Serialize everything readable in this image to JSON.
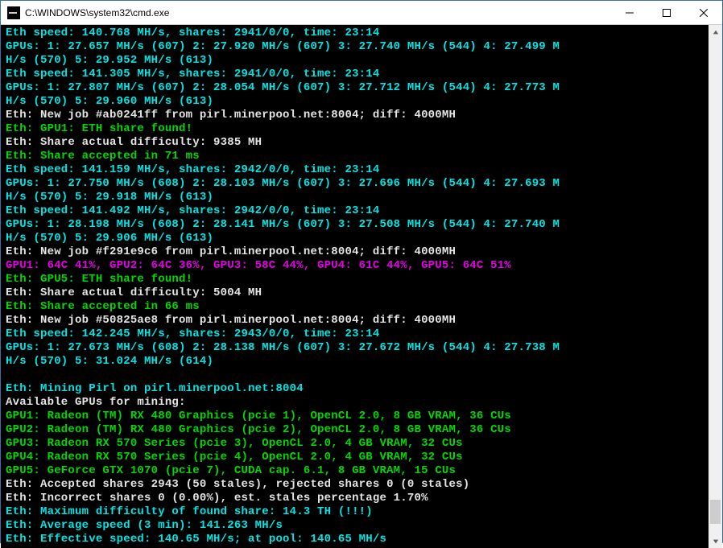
{
  "window": {
    "title": "C:\\WINDOWS\\system32\\cmd.exe"
  },
  "lines": [
    {
      "cls": "c-cyan",
      "t": "Eth speed: 140.768 MH/s, shares: 2941/0/0, time: 23:14"
    },
    {
      "cls": "c-cyan",
      "t": "GPUs: 1: 27.657 MH/s (607) 2: 27.920 MH/s (607) 3: 27.740 MH/s (544) 4: 27.499 M"
    },
    {
      "cls": "c-cyan",
      "t": "H/s (570) 5: 29.952 MH/s (613)"
    },
    {
      "cls": "c-cyan",
      "t": "Eth speed: 141.305 MH/s, shares: 2941/0/0, time: 23:14"
    },
    {
      "cls": "c-cyan",
      "t": "GPUs: 1: 27.807 MH/s (607) 2: 28.054 MH/s (607) 3: 27.712 MH/s (544) 4: 27.773 M"
    },
    {
      "cls": "c-cyan",
      "t": "H/s (570) 5: 29.960 MH/s (613)"
    },
    {
      "cls": "c-white",
      "t": "Eth: New job #ab0241ff from pirl.minerpool.net:8004; diff: 4000MH"
    },
    {
      "cls": "c-green",
      "t": "Eth: GPU1: ETH share found!"
    },
    {
      "cls": "c-white",
      "t": "Eth: Share actual difficulty: 9385 MH"
    },
    {
      "cls": "c-green",
      "t": "Eth: Share accepted in 71 ms"
    },
    {
      "cls": "c-cyan",
      "t": "Eth speed: 141.159 MH/s, shares: 2942/0/0, time: 23:14"
    },
    {
      "cls": "c-cyan",
      "t": "GPUs: 1: 27.750 MH/s (608) 2: 28.103 MH/s (607) 3: 27.696 MH/s (544) 4: 27.693 M"
    },
    {
      "cls": "c-cyan",
      "t": "H/s (570) 5: 29.918 MH/s (613)"
    },
    {
      "cls": "c-cyan",
      "t": "Eth speed: 141.492 MH/s, shares: 2942/0/0, time: 23:14"
    },
    {
      "cls": "c-cyan",
      "t": "GPUs: 1: 28.198 MH/s (608) 2: 28.141 MH/s (607) 3: 27.508 MH/s (544) 4: 27.740 M"
    },
    {
      "cls": "c-cyan",
      "t": "H/s (570) 5: 29.906 MH/s (613)"
    },
    {
      "cls": "c-white",
      "t": "Eth: New job #f291e9c6 from pirl.minerpool.net:8004; diff: 4000MH"
    },
    {
      "cls": "c-magenta",
      "t": "GPU1: 64C 41%, GPU2: 64C 36%, GPU3: 58C 44%, GPU4: 61C 44%, GPU5: 64C 51%"
    },
    {
      "cls": "c-green",
      "t": "Eth: GPU5: ETH share found!"
    },
    {
      "cls": "c-white",
      "t": "Eth: Share actual difficulty: 5004 MH"
    },
    {
      "cls": "c-green",
      "t": "Eth: Share accepted in 66 ms"
    },
    {
      "cls": "c-white",
      "t": "Eth: New job #50825ae8 from pirl.minerpool.net:8004; diff: 4000MH"
    },
    {
      "cls": "c-cyan",
      "t": "Eth speed: 142.245 MH/s, shares: 2943/0/0, time: 23:14"
    },
    {
      "cls": "c-cyan",
      "t": "GPUs: 1: 27.673 MH/s (608) 2: 28.138 MH/s (607) 3: 27.672 MH/s (544) 4: 27.738 M"
    },
    {
      "cls": "c-cyan",
      "t": "H/s (570) 5: 31.024 MH/s (614)"
    },
    {
      "cls": "c-cyan",
      "t": ""
    },
    {
      "cls": "c-cyan",
      "t": "Eth: Mining Pirl on pirl.minerpool.net:8004"
    },
    {
      "cls": "c-white",
      "t": "Available GPUs for mining:"
    },
    {
      "cls": "c-green",
      "t": "GPU1: Radeon (TM) RX 480 Graphics (pcie 1), OpenCL 2.0, 8 GB VRAM, 36 CUs"
    },
    {
      "cls": "c-green",
      "t": "GPU2: Radeon (TM) RX 480 Graphics (pcie 2), OpenCL 2.0, 8 GB VRAM, 36 CUs"
    },
    {
      "cls": "c-green",
      "t": "GPU3: Radeon RX 570 Series (pcie 3), OpenCL 2.0, 4 GB VRAM, 32 CUs"
    },
    {
      "cls": "c-green",
      "t": "GPU4: Radeon RX 570 Series (pcie 4), OpenCL 2.0, 4 GB VRAM, 32 CUs"
    },
    {
      "cls": "c-green",
      "t": "GPU5: GeForce GTX 1070 (pcie 7), CUDA cap. 6.1, 8 GB VRAM, 15 CUs"
    },
    {
      "cls": "c-white",
      "t": "Eth: Accepted shares 2943 (50 stales), rejected shares 0 (0 stales)"
    },
    {
      "cls": "c-white",
      "t": "Eth: Incorrect shares 0 (0.00%), est. stales percentage 1.70%"
    },
    {
      "cls": "c-cyan",
      "t": "Eth: Maximum difficulty of found share: 14.3 TH (!!!)"
    },
    {
      "cls": "c-cyan",
      "t": "Eth: Average speed (3 min): 141.263 MH/s"
    },
    {
      "cls": "c-cyan",
      "t": "Eth: Effective speed: 140.65 MH/s; at pool: 140.65 MH/s"
    }
  ]
}
